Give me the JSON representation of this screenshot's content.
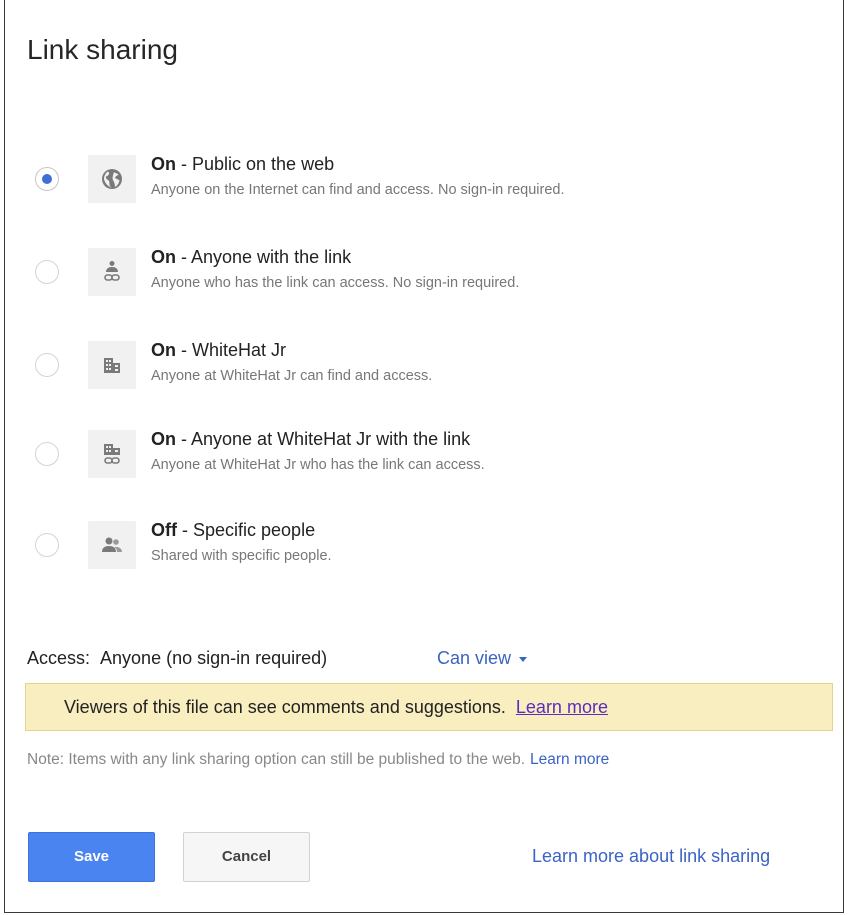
{
  "dialog": {
    "title": "Link sharing"
  },
  "options": [
    {
      "state": "On",
      "label": " - Public on the web",
      "description": "Anyone on the Internet can find and access. No sign-in required.",
      "icon": "globe-icon",
      "selected": true
    },
    {
      "state": "On",
      "label": " - Anyone with the link",
      "description": "Anyone who has the link can access. No sign-in required.",
      "icon": "person-link-icon",
      "selected": false
    },
    {
      "state": "On",
      "label": " - WhiteHat Jr",
      "description": "Anyone at WhiteHat Jr can find and access.",
      "icon": "building-icon",
      "selected": false
    },
    {
      "state": "On",
      "label": " - Anyone at WhiteHat Jr with the link",
      "description": "Anyone at WhiteHat Jr who has the link can access.",
      "icon": "building-link-icon",
      "selected": false
    },
    {
      "state": "Off",
      "label": " - Specific people",
      "description": "Shared with specific people.",
      "icon": "people-icon",
      "selected": false
    }
  ],
  "access": {
    "label": "Access:",
    "value": "Anyone (no sign-in required)",
    "permission": "Can view"
  },
  "banner": {
    "text": "Viewers of this file can see comments and suggestions.",
    "link": "Learn more"
  },
  "note": {
    "text": "Note: Items with any link sharing option can still be published to the web.",
    "link": "Learn more"
  },
  "buttons": {
    "save": "Save",
    "cancel": "Cancel",
    "learn_more_sharing": "Learn more about link sharing"
  },
  "colors": {
    "accent": "#4a84f0",
    "link": "#3b63c4",
    "banner_bg": "#f9eec0",
    "visited_link": "#5b2dbd"
  }
}
